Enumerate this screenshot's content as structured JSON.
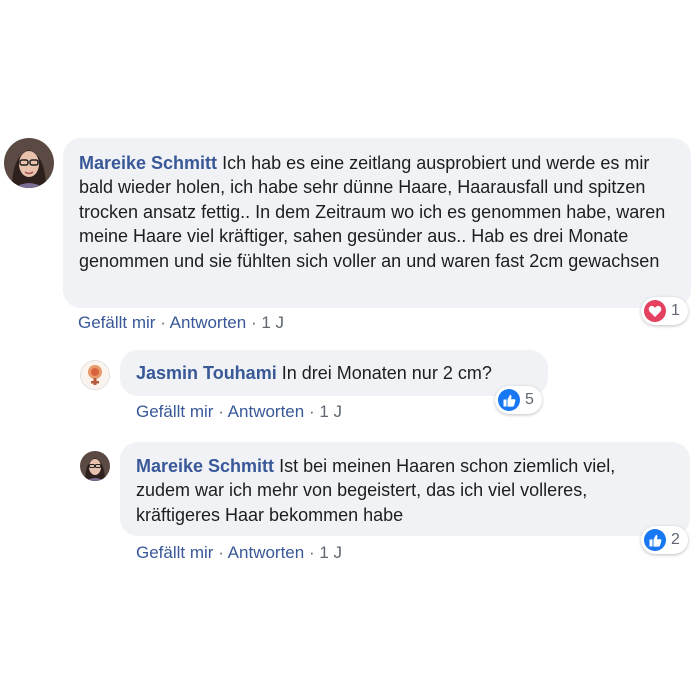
{
  "comments": [
    {
      "author": "Mareike Schmitt",
      "text": "Ich hab es eine zeitlang ausprobiert und werde es mir bald wieder holen, ich habe sehr dünne Haare, Haarausfall und spitzen trocken ansatz fettig.. In dem Zeitraum wo ich es genommen habe, waren meine Haare viel kräftiger, sahen gesünder aus.. Hab es drei Monate genommen und sie fühlten sich voller an und waren fast 2cm gewachsen",
      "like_label": "Gefällt mir",
      "reply_label": "Antworten",
      "separator": "·",
      "time": "1 J",
      "reaction": {
        "icon": "heart-icon",
        "color": "#e4405f",
        "count": "1"
      }
    },
    {
      "author": "Jasmin Touhami",
      "text": "In drei Monaten nur 2 cm?",
      "like_label": "Gefällt mir",
      "reply_label": "Antworten",
      "separator": "·",
      "time": "1 J",
      "reaction": {
        "icon": "thumbs-up-icon",
        "color": "#1877f2",
        "count": "5"
      }
    },
    {
      "author": "Mareike Schmitt",
      "text": "Ist bei meinen Haaren schon ziemlich viel, zudem war ich mehr von begeistert, das ich viel volleres, kräftigeres Haar bekommen habe",
      "like_label": "Gefällt mir",
      "reply_label": "Antworten",
      "separator": "·",
      "time": "1 J",
      "reaction": {
        "icon": "thumbs-up-icon",
        "color": "#1877f2",
        "count": "2"
      }
    }
  ]
}
